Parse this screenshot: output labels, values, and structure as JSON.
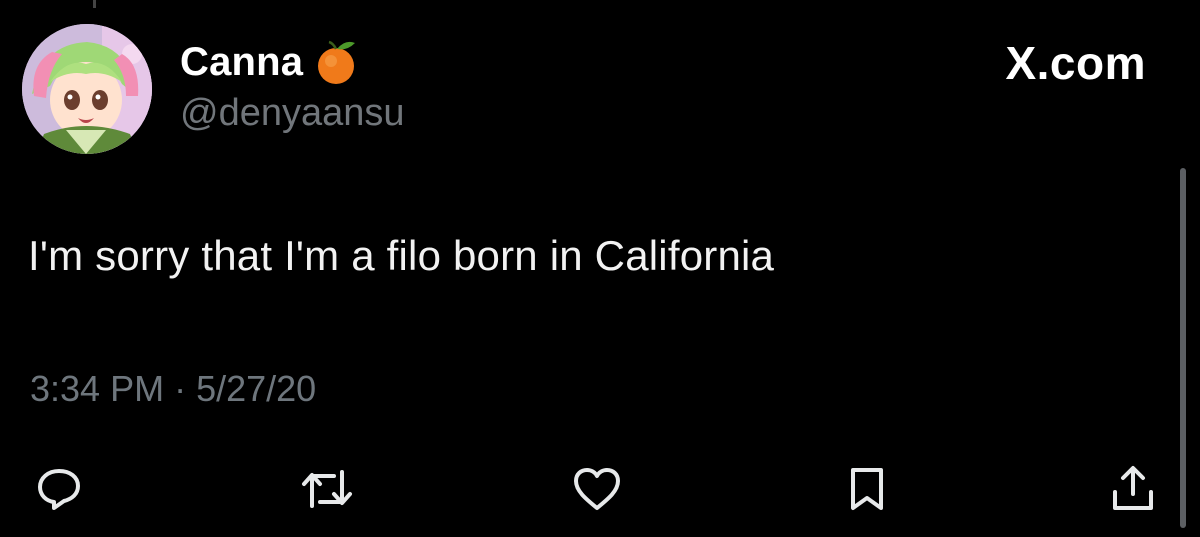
{
  "header": {
    "display_name": "Canna",
    "handle": "@denyaansu",
    "brand": "X.com"
  },
  "tweet": {
    "text": "I'm sorry that I'm a filo born in California",
    "time": "3:34 PM",
    "separator": "·",
    "date": "5/27/20"
  },
  "icons": {
    "emoji": "orange-emoji-icon",
    "actions": [
      "reply-icon",
      "retweet-icon",
      "like-icon",
      "bookmark-icon",
      "share-icon"
    ]
  },
  "colors": {
    "background": "#000000",
    "primary_text": "#ffffff",
    "secondary_text": "#71767b",
    "icon": "#9aa0a6"
  }
}
